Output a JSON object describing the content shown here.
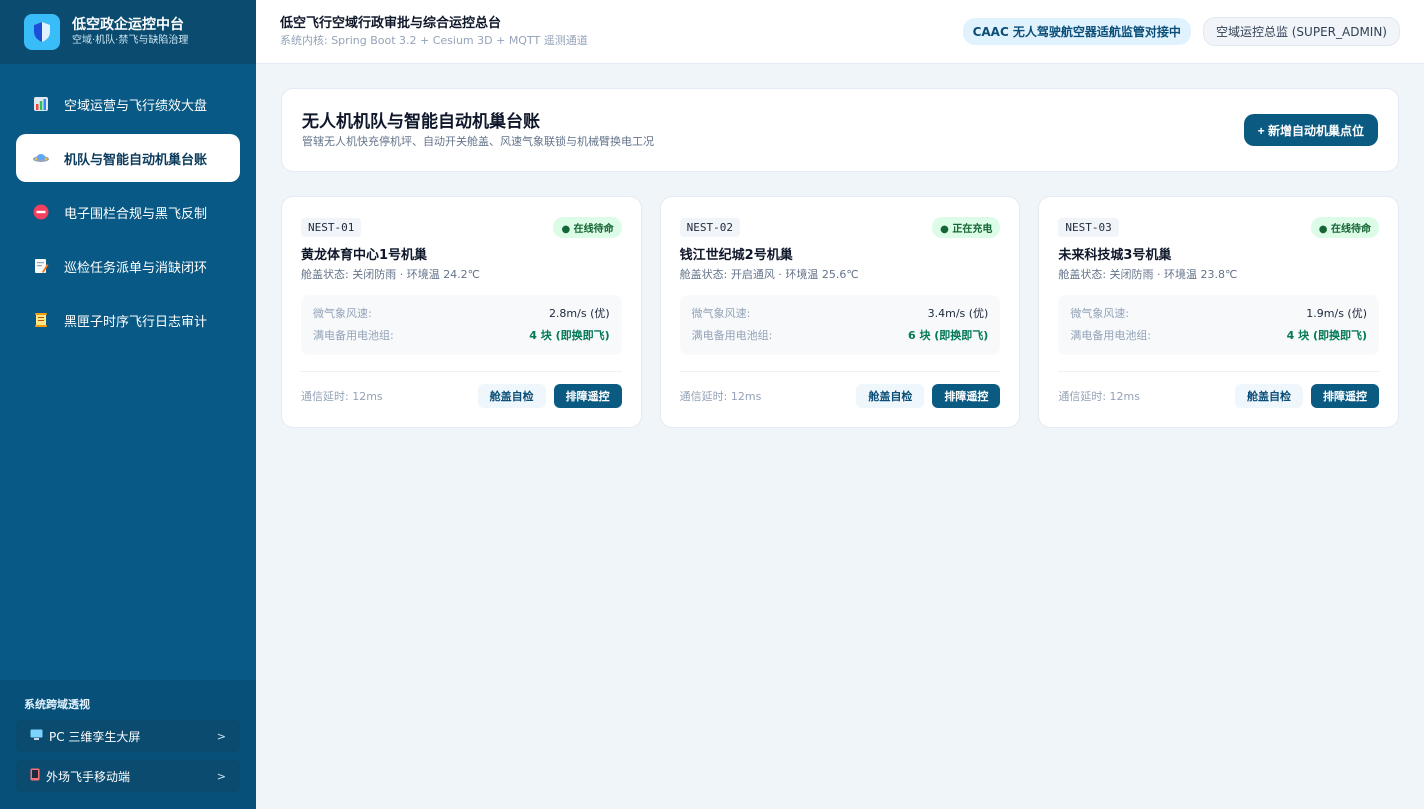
{
  "brand": {
    "title": "低空政企运控中台",
    "subtitle": "空域·机队·禁飞与缺陷治理"
  },
  "nav": [
    {
      "label": "空域运营与飞行绩效大盘",
      "icon": "bar-chart-icon"
    },
    {
      "label": "机队与智能自动机巢台账",
      "icon": "drone-icon",
      "active": true
    },
    {
      "label": "电子围栏合规与黑飞反制",
      "icon": "no-entry-icon"
    },
    {
      "label": "巡检任务派单与消缺闭环",
      "icon": "clipboard-icon"
    },
    {
      "label": "黑匣子时序飞行日志审计",
      "icon": "scroll-icon"
    }
  ],
  "sidebar_bottom": {
    "title": "系统跨域透视",
    "links": [
      {
        "label": "PC 三维孪生大屏",
        "arrow": ">",
        "icon": "monitor-icon"
      },
      {
        "label": "外场飞手移动端",
        "arrow": ">",
        "icon": "phone-icon"
      }
    ]
  },
  "header": {
    "title": "低空飞行空域行政审批与综合运控总台",
    "subtitle": "系统内核: Spring Boot 3.2 + Cesium 3D + MQTT 遥测通道",
    "badge": "CAAC 无人驾驶航空器适航监管对接中",
    "user": "空域运控总监 (SUPER_ADMIN)"
  },
  "panel": {
    "title": "无人机机队与智能自动机巢台账",
    "subtitle": "管辖无人机快充停机坪、自动开关舱盖、风速气象联锁与机械臂换电工况",
    "add_button": "+ 新增自动机巢点位"
  },
  "cards": [
    {
      "id": "NEST-01",
      "status": "● 在线待命",
      "name": "黄龙体育中心1号机巢",
      "cover": "舱盖状态: 关闭防雨 · 环境温 24.2℃",
      "wind_label": "微气象风速:",
      "wind_value": "2.8m/s (优)",
      "battery_label": "满电备用电池组:",
      "battery_value": "4 块 (即换即飞)",
      "latency": "通信延时: 12ms",
      "btn_check": "舱盖自检",
      "btn_remote": "排障遥控"
    },
    {
      "id": "NEST-02",
      "status": "● 正在充电",
      "name": "钱江世纪城2号机巢",
      "cover": "舱盖状态: 开启通风 · 环境温 25.6℃",
      "wind_label": "微气象风速:",
      "wind_value": "3.4m/s (优)",
      "battery_label": "满电备用电池组:",
      "battery_value": "6 块 (即换即飞)",
      "latency": "通信延时: 12ms",
      "btn_check": "舱盖自检",
      "btn_remote": "排障遥控"
    },
    {
      "id": "NEST-03",
      "status": "● 在线待命",
      "name": "未来科技城3号机巢",
      "cover": "舱盖状态: 关闭防雨 · 环境温 23.8℃",
      "wind_label": "微气象风速:",
      "wind_value": "1.9m/s (优)",
      "battery_label": "满电备用电池组:",
      "battery_value": "4 块 (即换即飞)",
      "latency": "通信延时: 12ms",
      "btn_check": "舱盖自检",
      "btn_remote": "排障遥控"
    }
  ]
}
